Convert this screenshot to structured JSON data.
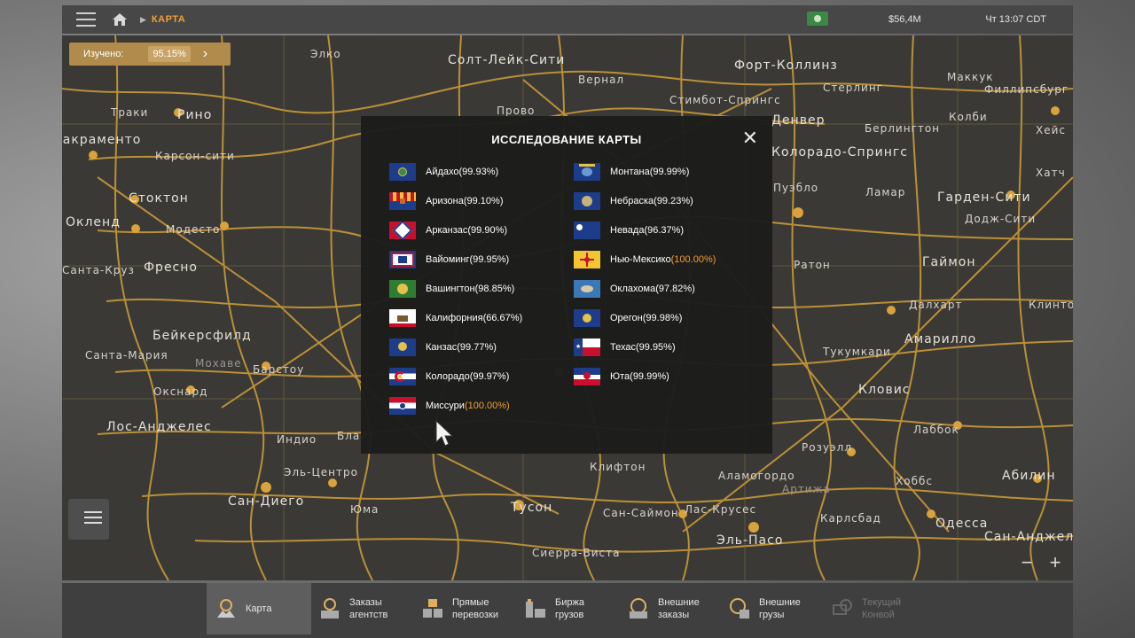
{
  "topbar": {
    "breadcrumb": "КАРТА",
    "money": "$56,4M",
    "clock": "Чт 13:07 CDT"
  },
  "explored": {
    "label": "Изучено:",
    "value": "95.15%"
  },
  "map_cities": [
    "Элко",
    "Солт-Лейк-Сити",
    "Форт-Коллинз",
    "Вернал",
    "Маккук",
    "Стерлинг",
    "Филлипсбург",
    "Траки",
    "Рино",
    "Прово",
    "Стимбот-Спрингс",
    "Денвер",
    "Берлингтон",
    "Колби",
    "Хейс",
    "Сакраменто",
    "Карсон-сити",
    "Колорадо-Спрингс",
    "Стоктон",
    "Пуэбло",
    "Ламар",
    "Гарден-Сити",
    "Хатч",
    "Окленд",
    "Модесто",
    "Додж-Сити",
    "Санта-Круз",
    "Фресно",
    "Гаймон",
    "Ратон",
    "Бейкерсфилд",
    "Далхарт",
    "Клинтон",
    "Санта-Мария",
    "Мохаве",
    "Барстоу",
    "Амарилло",
    "Тукумкари",
    "Окснард",
    "Кловис",
    "Лос-Анджелес",
    "Индио",
    "Лаббок",
    "Розуэлл",
    "Эль-Центро",
    "Сан-Диего",
    "Юма",
    "Тусон",
    "Аламогордо",
    "Артижа",
    "Хоббс",
    "Абилин",
    "Лас-Крусес",
    "Карлсбад",
    "Сан-Саймон",
    "Одесса",
    "Эль-Пасо",
    "Сан-Анджело",
    "Сиерра-Виста",
    "Клифтон",
    "Блайт"
  ],
  "modal": {
    "title": "ИССЛЕДОВАНИЕ КАРТЫ",
    "left": [
      {
        "name": "Айдахо",
        "pct": "(99.93%)",
        "full": false,
        "flag": "idaho"
      },
      {
        "name": "Аризона",
        "pct": "(99.10%)",
        "full": false,
        "flag": "arizona"
      },
      {
        "name": "Арканзас",
        "pct": "(99.90%)",
        "full": false,
        "flag": "arkansas"
      },
      {
        "name": "Вайоминг",
        "pct": "(99.95%)",
        "full": false,
        "flag": "wyoming"
      },
      {
        "name": "Вашингтон",
        "pct": "(98.85%)",
        "full": false,
        "flag": "washington"
      },
      {
        "name": "Калифорния",
        "pct": "(66.67%)",
        "full": false,
        "flag": "california"
      },
      {
        "name": "Канзас",
        "pct": "(99.77%)",
        "full": false,
        "flag": "kansas"
      },
      {
        "name": "Колорадо",
        "pct": "(99.97%)",
        "full": false,
        "flag": "colorado"
      },
      {
        "name": "Миссури",
        "pct": "(100.00%)",
        "full": true,
        "flag": "missouri"
      }
    ],
    "right": [
      {
        "name": "Монтана",
        "pct": "(99.99%)",
        "full": false,
        "flag": "montana"
      },
      {
        "name": "Небраска",
        "pct": "(99.23%)",
        "full": false,
        "flag": "nebraska"
      },
      {
        "name": "Невада",
        "pct": "(96.37%)",
        "full": false,
        "flag": "nevada"
      },
      {
        "name": "Нью-Мексико",
        "pct": "(100.00%)",
        "full": true,
        "flag": "newmexico"
      },
      {
        "name": "Оклахома",
        "pct": "(97.82%)",
        "full": false,
        "flag": "oklahoma"
      },
      {
        "name": "Орегон",
        "pct": "(99.98%)",
        "full": false,
        "flag": "oregon"
      },
      {
        "name": "Техас",
        "pct": "(99.95%)",
        "full": false,
        "flag": "texas"
      },
      {
        "name": "Юта",
        "pct": "(99.99%)",
        "full": false,
        "flag": "utah"
      }
    ]
  },
  "bottom_tabs": [
    {
      "line1": "Карта",
      "line2": "",
      "icon": "map-icon",
      "active": true,
      "disabled": false
    },
    {
      "line1": "Заказы",
      "line2": "агентств",
      "icon": "clock-crate-icon",
      "active": false,
      "disabled": false
    },
    {
      "line1": "Прямые",
      "line2": "перевозки",
      "icon": "crates-icon",
      "active": false,
      "disabled": false
    },
    {
      "line1": "Биржа",
      "line2": "грузов",
      "icon": "cargo-market-icon",
      "active": false,
      "disabled": false
    },
    {
      "line1": "Внешние",
      "line2": "заказы",
      "icon": "globe-crate-icon",
      "active": false,
      "disabled": false
    },
    {
      "line1": "Внешние",
      "line2": "грузы",
      "icon": "globe-cargo-icon",
      "active": false,
      "disabled": false
    },
    {
      "line1": "Текущий",
      "line2": "Конвой",
      "icon": "convoy-icon",
      "active": false,
      "disabled": true
    }
  ],
  "colors": {
    "accent": "#f0a030",
    "road": "#d4a23c",
    "panel": "#1c1c1c",
    "topbar": "#474747"
  }
}
